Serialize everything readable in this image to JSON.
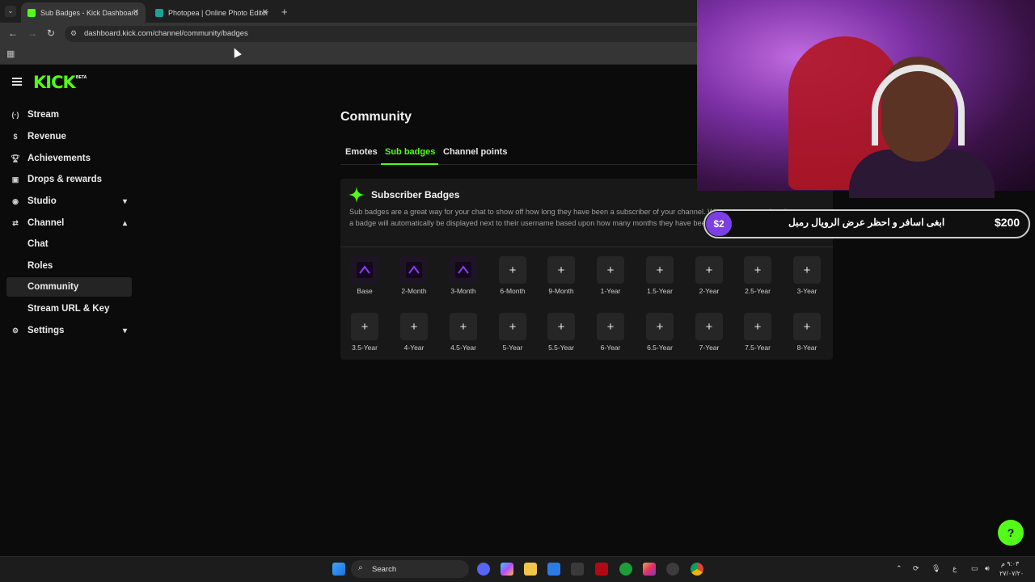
{
  "browser": {
    "tabs": [
      {
        "title": "Sub Badges - Kick Dashboard",
        "favicon_color": "#53fc18",
        "active": true
      },
      {
        "title": "Photopea | Online Photo Editor",
        "favicon_color": "#18a497",
        "active": false
      }
    ],
    "url": "dashboard.kick.com/channel/community/badges"
  },
  "brand": {
    "logo": "KICK",
    "beta": "BETA",
    "accent": "#53fc18"
  },
  "sidebar": {
    "items": [
      {
        "label": "Stream",
        "icon": "broadcast-icon"
      },
      {
        "label": "Revenue",
        "icon": "dollar-icon"
      },
      {
        "label": "Achievements",
        "icon": "trophy-icon"
      },
      {
        "label": "Drops & rewards",
        "icon": "gift-icon"
      },
      {
        "label": "Studio",
        "icon": "studio-icon",
        "expandable": true,
        "expanded": false
      },
      {
        "label": "Channel",
        "icon": "channel-icon",
        "expandable": true,
        "expanded": true
      },
      {
        "label": "Chat",
        "sub": true
      },
      {
        "label": "Roles",
        "sub": true
      },
      {
        "label": "Community",
        "sub": true,
        "active": true
      },
      {
        "label": "Stream URL & Key",
        "sub": true
      },
      {
        "label": "Settings",
        "icon": "gear-icon",
        "expandable": true,
        "expanded": false
      }
    ]
  },
  "page": {
    "title": "Community",
    "tabs": [
      "Emotes",
      "Sub badges",
      "Channel points"
    ],
    "active_tab": "Sub badges"
  },
  "card": {
    "title": "Subscriber Badges",
    "description": "Sub badges are a great way for your chat to show off how long they have been a subscriber of your channel. When someone subscribes, a badge will automatically be displayed next to their username based upon how many months they have been subscribed for.",
    "badges_row1": [
      "Base",
      "2-Month",
      "3-Month",
      "6-Month",
      "9-Month",
      "1-Year",
      "1.5-Year",
      "2-Year",
      "2.5-Year",
      "3-Year"
    ],
    "badges_row2": [
      "3.5-Year",
      "4-Year",
      "4.5-Year",
      "5-Year",
      "5.5-Year",
      "6-Year",
      "6.5-Year",
      "7-Year",
      "7.5-Year",
      "8-Year"
    ],
    "uploaded": [
      "Base",
      "2-Month",
      "3-Month"
    ]
  },
  "overlay": {
    "donation_small": "$2",
    "donation_message": "ابغى اسافر و احظر عرض الرويال رمبل",
    "donation_amount": "$200"
  },
  "taskbar": {
    "search_placeholder": "Search",
    "tray_lang": "ع",
    "time": "٩:٠٣ م",
    "date": "٢٧/٠٧/٢٠"
  }
}
